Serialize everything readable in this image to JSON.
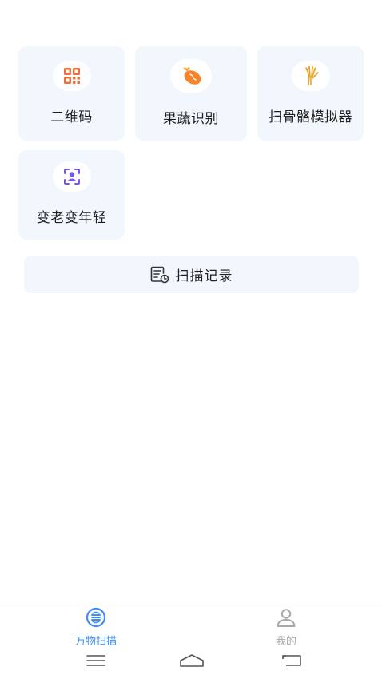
{
  "features": {
    "qr": {
      "label": "二维码",
      "icon": "qr-code-icon",
      "color": "#f0703a"
    },
    "veg": {
      "label": "果蔬识别",
      "icon": "carrot-icon",
      "color": "#f5842a"
    },
    "bone": {
      "label": "扫骨骼模拟器",
      "icon": "hand-bone-icon",
      "color": "#e4a72b"
    },
    "age": {
      "label": "变老变年轻",
      "icon": "face-scan-icon",
      "color": "#7a55e6"
    }
  },
  "record_button": {
    "label": "扫描记录",
    "icon": "scan-record-icon"
  },
  "tabs": [
    {
      "label": "万物扫描",
      "icon": "scan-icon",
      "active": true,
      "color": "#3f8ef0"
    },
    {
      "label": "我的",
      "icon": "user-icon",
      "active": false,
      "color": "#a9a9a9"
    }
  ],
  "system_nav": [
    "menu-icon",
    "home-icon",
    "back-icon"
  ]
}
